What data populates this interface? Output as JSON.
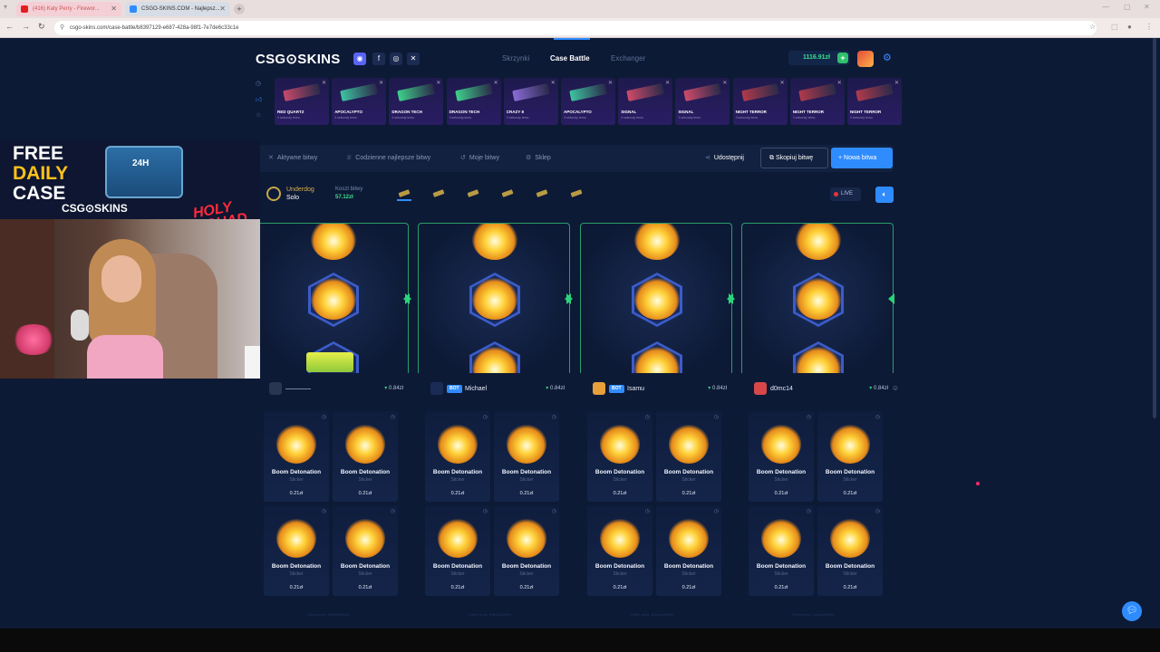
{
  "browser": {
    "tabs": [
      {
        "title": "(416) Katy Perry - Firewor...",
        "favicon_color": "#e02020"
      },
      {
        "title": "CSGO-SKINS.COM - Najlepsz...",
        "favicon_color": "#2f8cff"
      }
    ],
    "url": "csgo-skins.com/case-battle/b8397129-e687-428a-98f1-7e7de6c33c1e"
  },
  "site": {
    "logo": "CSG⊙SKINS",
    "nav": [
      {
        "label": "Skrzynki",
        "active": false
      },
      {
        "label": "Case Battle",
        "active": true
      },
      {
        "label": "Exchanger",
        "active": false
      }
    ],
    "balance": "1116.91zł"
  },
  "recent_drops": [
    {
      "name": "RED QUARTZ",
      "sub": "3 sekundy temu",
      "color": "#c84a6a"
    },
    {
      "name": "APOCALYPTO",
      "sub": "3 sekundy temu",
      "color": "#3ec3a0"
    },
    {
      "name": "DRAGON TECH",
      "sub": "3 sekundy temu",
      "color": "#3fd08a"
    },
    {
      "name": "DRAGON TECH",
      "sub": "3 sekundy temu",
      "color": "#3fd08a"
    },
    {
      "name": "CRAZY 8",
      "sub": "3 sekundy temu",
      "color": "#8b6bd8"
    },
    {
      "name": "APOCALYPTO",
      "sub": "3 sekundy temu",
      "color": "#3ec3a0"
    },
    {
      "name": "SIGNAL",
      "sub": "3 sekundy temu",
      "color": "#d04a6a"
    },
    {
      "name": "SIGNAL",
      "sub": "3 sekundy temu",
      "color": "#d04a6a"
    },
    {
      "name": "NIGHT TERROR",
      "sub": "3 sekundy temu",
      "color": "#b03a4a"
    },
    {
      "name": "NIGHT TERROR",
      "sub": "3 sekundy temu",
      "color": "#b03a4a"
    },
    {
      "name": "NIGHT TERROR",
      "sub": "3 sekundy temu",
      "color": "#b03a4a"
    }
  ],
  "toolbar": {
    "active_battles": "Aktywne bitwy",
    "daily_best": "Codzienne najlepsze bitwy",
    "my_battles": "Moje bitwy",
    "shop": "Sklep",
    "share": "Udostępnij",
    "copy_battle": "Skopiuj bitwę",
    "new_battle": "Nowa bitwa"
  },
  "battle": {
    "mode": "Underdog",
    "type": "Solo",
    "cost_label": "Koszt bitwy",
    "cost": "57.12zł",
    "live": "LIVE"
  },
  "players": [
    {
      "name": "————",
      "bot": false,
      "value": "0.84zł",
      "avatar_color": "#2a3550"
    },
    {
      "name": "Michael",
      "bot": true,
      "value": "0.84zł",
      "avatar_color": "#1a2c55"
    },
    {
      "name": "Isamu",
      "bot": true,
      "value": "0.84zł",
      "avatar_color": "#e8a03a"
    },
    {
      "name": "d0mc14",
      "bot": false,
      "value": "0.84zł",
      "avatar_color": "#d8484a"
    }
  ],
  "bot_label": "BOT",
  "item": {
    "name": "Boom Detonation",
    "type": "Sticker",
    "price": "0.21zł"
  },
  "seeds": [
    "Client seed: 1f4e1a2b9fd4",
    "Client seed: 1f4e1a2b9fd4",
    "Client seed: 1f4e1a2b9fd4",
    "Client seed: 1f4e1a2b9fd4"
  ],
  "overlay": {
    "promo_line1": "FREE",
    "promo_line2": "DAILY",
    "promo_line3": "CASE",
    "promo_brand": "CSG⊙SKINS",
    "promo_chest": "24H",
    "holy": "HOLY SQUAD"
  }
}
